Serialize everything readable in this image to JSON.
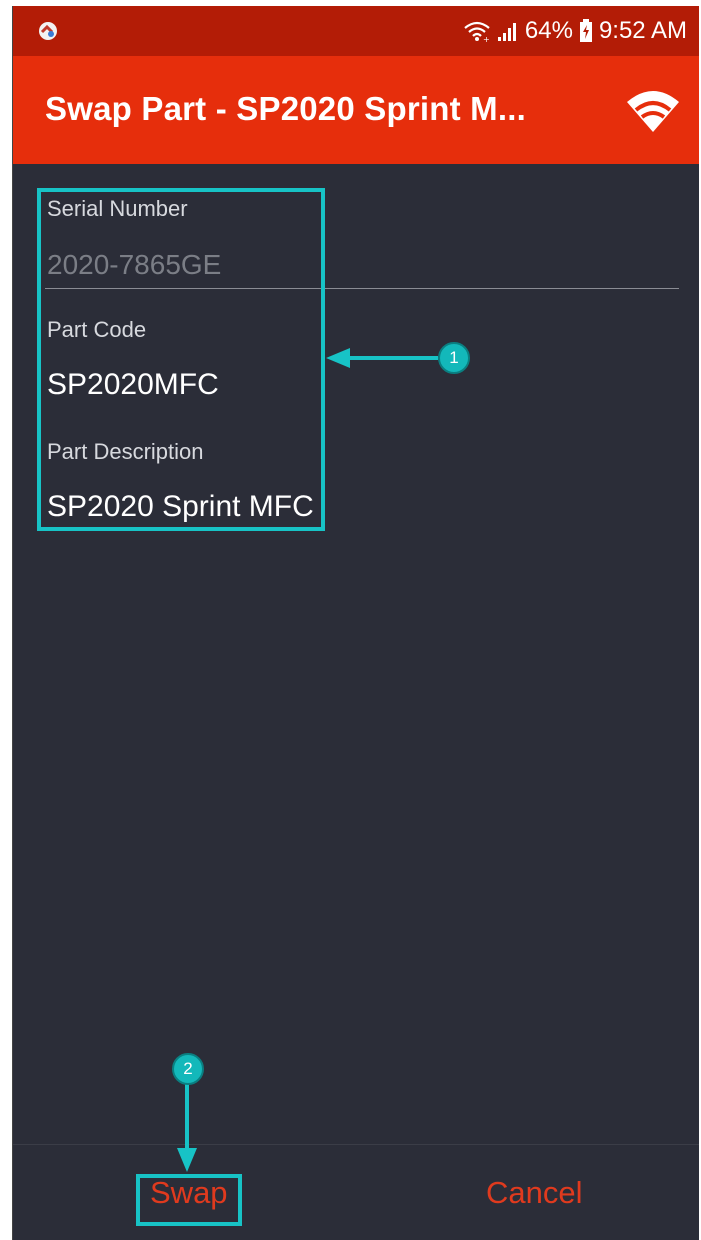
{
  "status_bar": {
    "battery": "64%",
    "time": "9:52 AM",
    "icons": [
      "app-notification-icon",
      "wifi-signal-icon",
      "cell-signal-icon",
      "battery-icon"
    ]
  },
  "app_bar": {
    "title": "Swap Part - SP2020 Sprint M...",
    "action_icon": "wifi-icon"
  },
  "form": {
    "serial_number": {
      "label": "Serial Number",
      "placeholder": "2020-7865GE"
    },
    "part_code": {
      "label": "Part Code",
      "value": "SP2020MFC"
    },
    "part_description": {
      "label": "Part Description",
      "value": "SP2020 Sprint MFC"
    }
  },
  "actions": {
    "swap_label": "Swap",
    "cancel_label": "Cancel"
  },
  "annotations": {
    "badge_1": "1",
    "badge_2": "2",
    "accent_color": "#17c3c6"
  },
  "colors": {
    "status_bar": "#b31c06",
    "app_bar": "#e62e0c",
    "background": "#2b2d38",
    "button_text": "#e03a1e"
  }
}
